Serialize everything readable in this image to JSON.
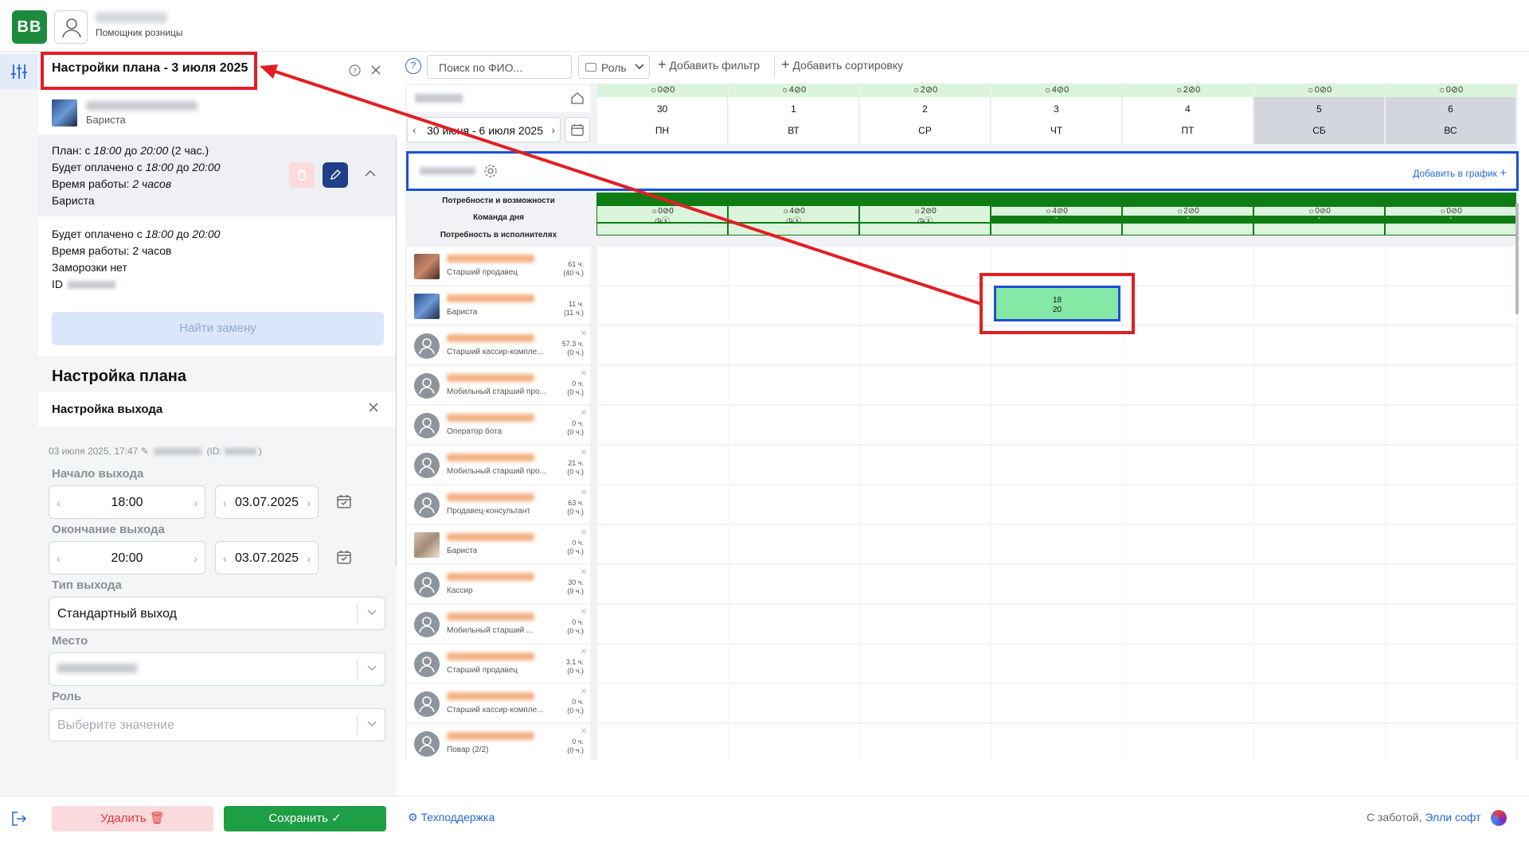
{
  "app": {
    "logo": "BB",
    "user_role": "Помощник розницы"
  },
  "panel": {
    "title": "Настройки плана - 3 июля 2025",
    "employee_role": "Бариста",
    "plan": {
      "l1_pre": "План: с ",
      "l1_from": "18:00",
      "l1_mid": " до ",
      "l1_to": "20:00",
      "l1_post": " (2 час.)",
      "l2_pre": "Будет оплачено с ",
      "l2_from": "18:00",
      "l2_mid": " до ",
      "l2_to": "20:00",
      "l3_pre": "Время работы: ",
      "l3_val": "2 часов",
      "l4": "Бариста"
    },
    "info": {
      "l1_pre": "Будет оплачено с ",
      "l1_from": "18:00",
      "l1_mid": " до ",
      "l1_to": "20:00",
      "l2": "Время работы: 2 часов",
      "l3": "Заморозки нет",
      "l4": "ID"
    },
    "find_replacement": "Найти замену",
    "setup_title": "Настройка плана",
    "setup_sub": "Настройка выхода",
    "meta_date": "03 июля 2025, 17:47",
    "meta_id_pre": "(ID:",
    "meta_id_post": ")",
    "start_label": "Начало выхода",
    "start_time": "18:00",
    "start_date": "03.07.2025",
    "end_label": "Окончание выхода",
    "end_time": "20:00",
    "end_date": "03.07.2025",
    "type_label": "Тип выхода",
    "type_value": "Стандартный выход",
    "place_label": "Место",
    "role_label": "Роль",
    "role_placeholder": "Выберите значение"
  },
  "footer": {
    "delete": "Удалить",
    "save": "Сохранить",
    "support": "Техподдержка",
    "care_pre": "С заботой, ",
    "care_brand": "Элли софт"
  },
  "toolbar": {
    "help": "?",
    "search_placeholder": "Поиск по ФИО...",
    "role": "Роль",
    "add_filter": "Добавить фильтр",
    "add_sort": "Добавить сортировку"
  },
  "schedule": {
    "date_range": "30 июня - 6 июля 2025",
    "add_to_schedule": "Добавить в график",
    "needs_labels": [
      "Потребности и возможности",
      "Команда дня",
      "Потребность в исполнителях"
    ],
    "days": [
      {
        "num": "30",
        "name": "ПН",
        "top": "☼0⊘0",
        "needs": "☼0⊘0",
        "weekend": false
      },
      {
        "num": "1",
        "name": "ВТ",
        "top": "☼4⊘0",
        "needs": "☼4⊘0",
        "weekend": false
      },
      {
        "num": "2",
        "name": "СР",
        "top": "☼2⊘0",
        "needs": "☼2⊘0",
        "weekend": false
      },
      {
        "num": "3",
        "name": "ЧТ",
        "top": "☼4⊘0",
        "needs": "☼4⊘0",
        "weekend": false
      },
      {
        "num": "4",
        "name": "ПТ",
        "top": "☼2⊘0",
        "needs": "☼2⊘0",
        "weekend": false
      },
      {
        "num": "5",
        "name": "СБ",
        "top": "☼0⊘0",
        "needs": "☼0⊘0",
        "weekend": true
      },
      {
        "num": "6",
        "name": "ВС",
        "top": "☼0⊘0",
        "needs": "☼0⊘0",
        "weekend": true
      }
    ],
    "employees": [
      {
        "role": "Старший продавец",
        "h1": "61 ч.",
        "h2": "(40 ч.)",
        "photo": true
      },
      {
        "role": "Бариста",
        "h1": "11 ч.",
        "h2": "(11 ч.)",
        "photo": true
      },
      {
        "role": "Старший кассир-компле...",
        "h1": "57.3 ч.",
        "h2": "(0 ч.)",
        "photo": false
      },
      {
        "role": "Мобильный старший про...",
        "h1": "0 ч.",
        "h2": "(0 ч.)",
        "photo": false
      },
      {
        "role": "Оператор бота",
        "h1": "0 ч.",
        "h2": "(0 ч.)",
        "photo": false
      },
      {
        "role": "Мобильный старший про...",
        "h1": "21 ч.",
        "h2": "(0 ч.)",
        "photo": false
      },
      {
        "role": "Продавец-консультант",
        "h1": "63 ч.",
        "h2": "(0 ч.)",
        "photo": false
      },
      {
        "role": "Бариста",
        "h1": "0 ч.",
        "h2": "(0 ч.)",
        "photo": true
      },
      {
        "role": "Кассир",
        "h1": "30 ч.",
        "h2": "(9 ч.)",
        "photo": false
      },
      {
        "role": "Мобильный старший ...",
        "h1": "0 ч.",
        "h2": "(0 ч.)",
        "photo": false
      },
      {
        "role": "Старший продавец",
        "h1": "3.1 ч.",
        "h2": "(0 ч.)",
        "photo": false
      },
      {
        "role": "Старший кассир-компле...",
        "h1": "0 ч.",
        "h2": "(0 ч.)",
        "photo": false
      },
      {
        "role": "Повар (2/2)",
        "h1": "0 ч.",
        "h2": "(0 ч.)",
        "photo": false
      }
    ],
    "shift": {
      "start": "18",
      "end": "20"
    }
  },
  "colors": {
    "brand_green": "#1e8a3c",
    "highlight_red": "#e31e24",
    "accent_blue": "#1d4fd6",
    "shift_green": "#86e8a5"
  }
}
